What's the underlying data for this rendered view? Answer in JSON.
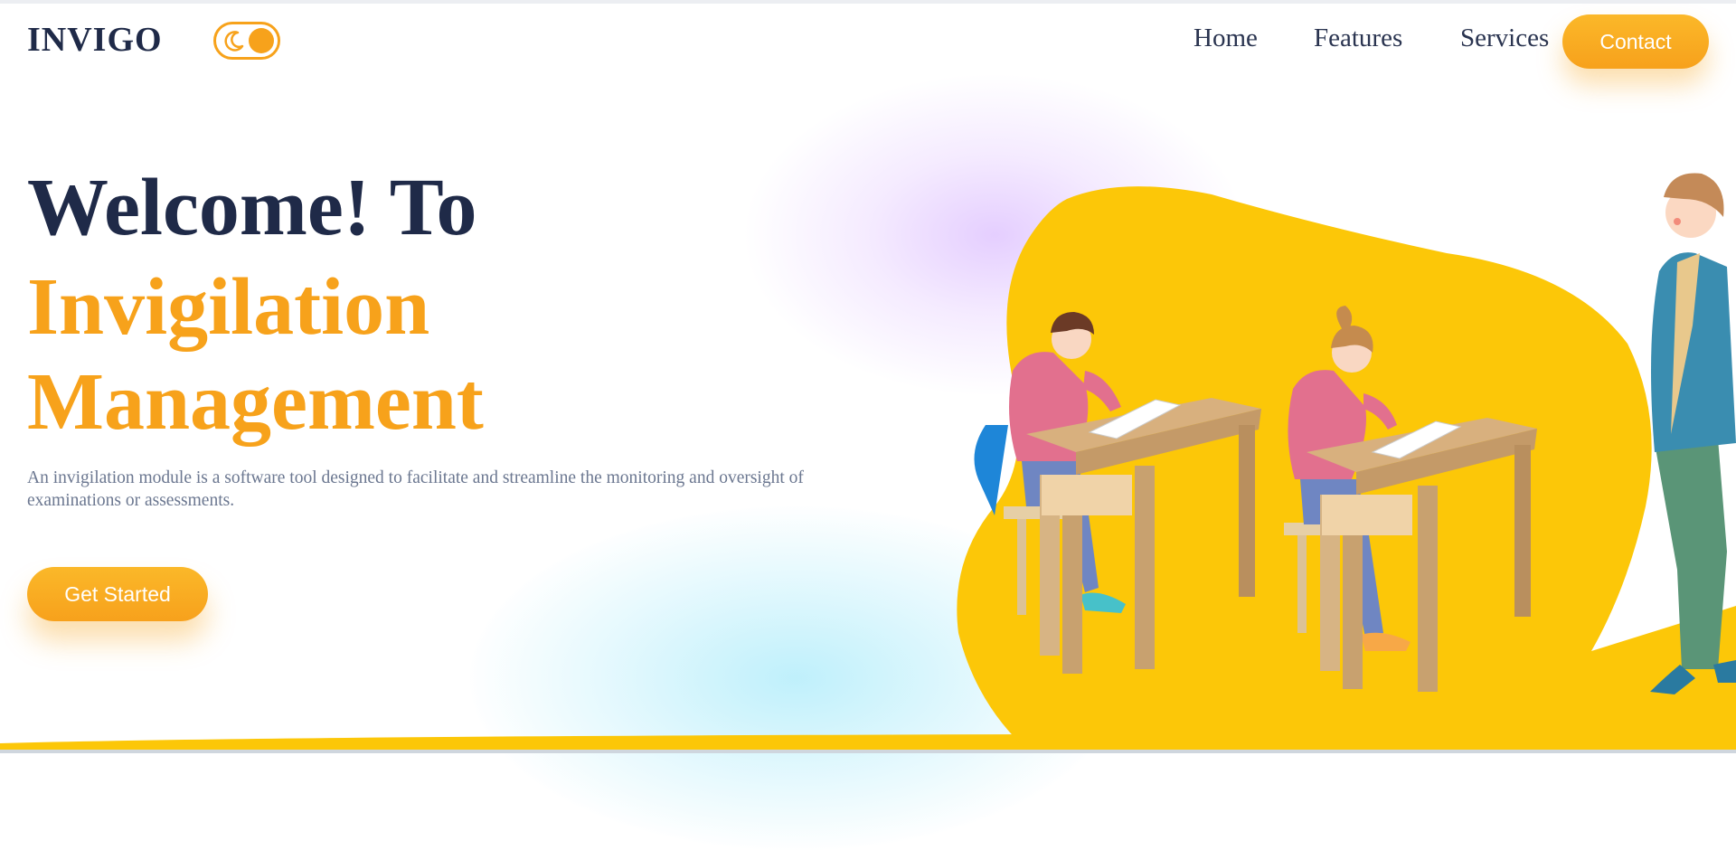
{
  "header": {
    "logo": "INVIGO",
    "nav": [
      "Home",
      "Features",
      "Services"
    ],
    "contact_label": "Contact",
    "theme_toggle_icon": "moon-icon"
  },
  "hero": {
    "title_line1": "Welcome! To",
    "title_line2": "Invigilation",
    "title_line3": "Management",
    "description": "An invigilation module is a software tool designed to facilitate and streamline the monitoring and oversight of examinations or assessments.",
    "cta_label": "Get Started"
  },
  "illustration": {
    "subject": "students-writing-exam-with-teacher-illustration"
  },
  "colors": {
    "accent": "#f7a21b",
    "heading": "#1f2a48",
    "text_muted": "#6b7790",
    "blob_yellow": "#fcc708"
  }
}
